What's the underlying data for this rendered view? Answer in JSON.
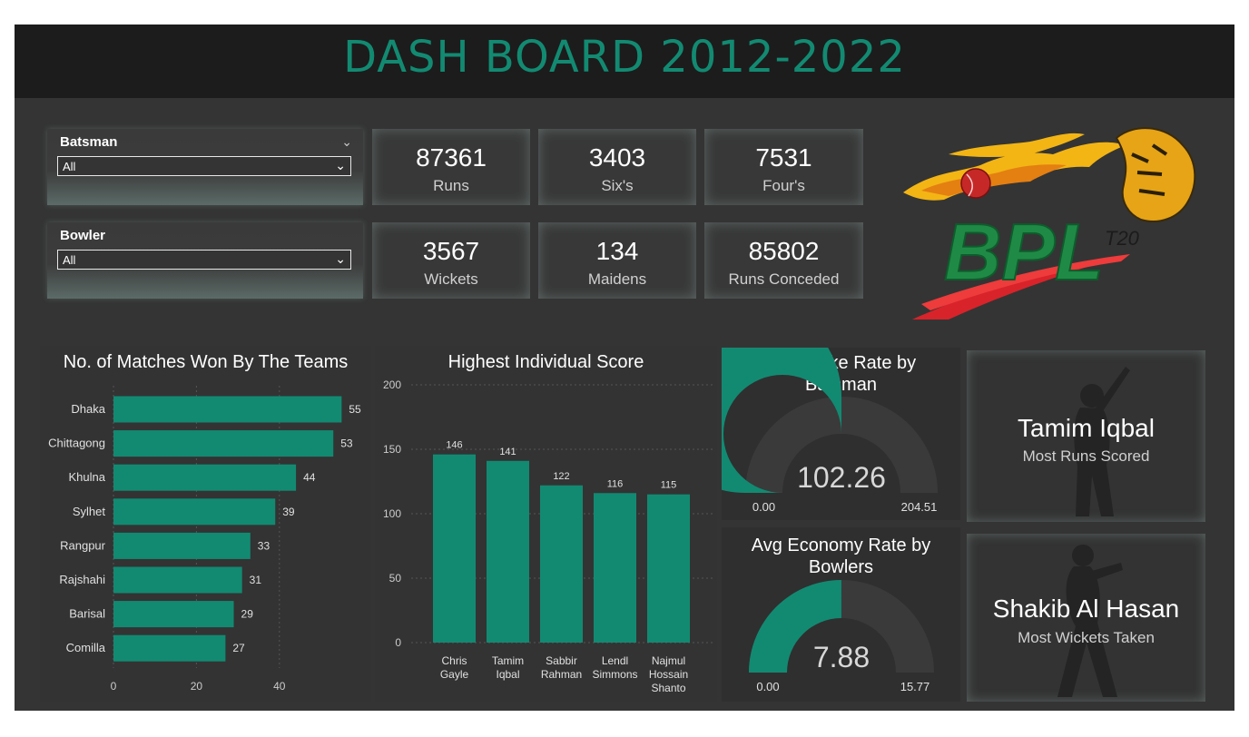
{
  "header": {
    "title": "DASH BOARD 2012-2022"
  },
  "slicers": [
    {
      "label": "Batsman",
      "value": "All"
    },
    {
      "label": "Bowler",
      "value": "All"
    }
  ],
  "kpis": [
    {
      "value": "87361",
      "label": "Runs"
    },
    {
      "value": "3403",
      "label": "Six's"
    },
    {
      "value": "7531",
      "label": "Four's"
    },
    {
      "value": "3567",
      "label": "Wickets"
    },
    {
      "value": "134",
      "label": "Maidens"
    },
    {
      "value": "85802",
      "label": "Runs Conceded"
    }
  ],
  "logo": {
    "text": "BPL",
    "subtext": "T20"
  },
  "gauges": [
    {
      "title_line1": "Avg Strike Rate by",
      "title_line2": "Batsman",
      "value": 102.26,
      "value_label": "102.26",
      "min_label": "0.00",
      "max_label": "204.51",
      "max": 204.51
    },
    {
      "title_line1": "Avg Economy Rate by",
      "title_line2": "Bowlers",
      "value": 7.88,
      "value_label": "7.88",
      "min_label": "0.00",
      "max_label": "15.77",
      "max": 15.77
    }
  ],
  "cards": [
    {
      "name": "Tamim Iqbal",
      "desc": "Most Runs Scored"
    },
    {
      "name": "Shakib Al Hasan",
      "desc": "Most Wickets Taken"
    }
  ],
  "colors": {
    "accent": "#128a72",
    "background": "#343434",
    "header_bg": "#1c1c1c"
  },
  "chart_data": [
    {
      "type": "bar",
      "orientation": "horizontal",
      "title": "No. of Matches Won By The Teams",
      "categories": [
        "Dhaka",
        "Chittagong",
        "Khulna",
        "Sylhet",
        "Rangpur",
        "Rajshahi",
        "Barisal",
        "Comilla"
      ],
      "values": [
        55,
        53,
        44,
        39,
        33,
        31,
        29,
        27
      ],
      "xticks": [
        0,
        20,
        40
      ],
      "xlim": [
        0,
        55
      ]
    },
    {
      "type": "bar",
      "title": "Highest Individual Score",
      "categories": [
        [
          "Chris",
          "Gayle"
        ],
        [
          "Tamim",
          "Iqbal"
        ],
        [
          "Sabbir",
          "Rahman"
        ],
        [
          "Lendl",
          "Simmons"
        ],
        [
          "Najmul",
          "Hossain",
          "Shanto"
        ]
      ],
      "values": [
        146,
        141,
        122,
        116,
        115
      ],
      "yticks": [
        0,
        50,
        100,
        150,
        200
      ],
      "ylim": [
        0,
        200
      ]
    }
  ]
}
